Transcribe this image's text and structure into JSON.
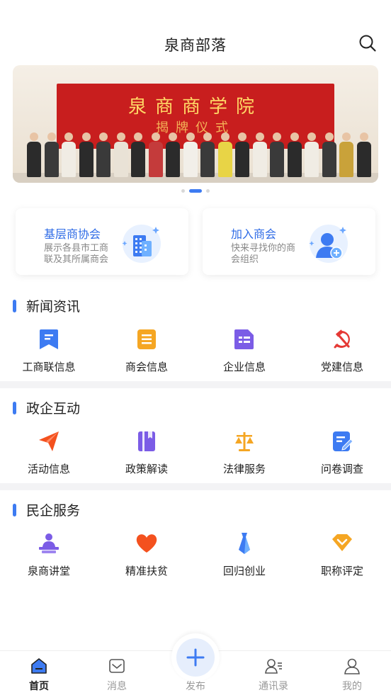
{
  "header": {
    "title": "泉商部落"
  },
  "banner": {
    "caption": "泉商商学院",
    "caption_sub": "揭牌仪式"
  },
  "cards": [
    {
      "title": "基层商协会",
      "desc": "展示各县市工商联及其所属商会"
    },
    {
      "title": "加入商会",
      "desc": "快来寻找你的商会组织"
    }
  ],
  "sections": [
    {
      "title": "新闻资讯",
      "items": [
        "工商联信息",
        "商会信息",
        "企业信息",
        "党建信息"
      ]
    },
    {
      "title": "政企互动",
      "items": [
        "活动信息",
        "政策解读",
        "法律服务",
        "问卷调查"
      ]
    },
    {
      "title": "民企服务",
      "items": [
        "泉商讲堂",
        "精准扶贫",
        "回归创业",
        "职称评定"
      ]
    }
  ],
  "tabbar": {
    "items": [
      "首页",
      "消息",
      "发布",
      "通讯录",
      "我的"
    ],
    "active": "首页"
  },
  "colors": {
    "accent": "#3d7bf2",
    "banner_red": "#c81e1e"
  }
}
